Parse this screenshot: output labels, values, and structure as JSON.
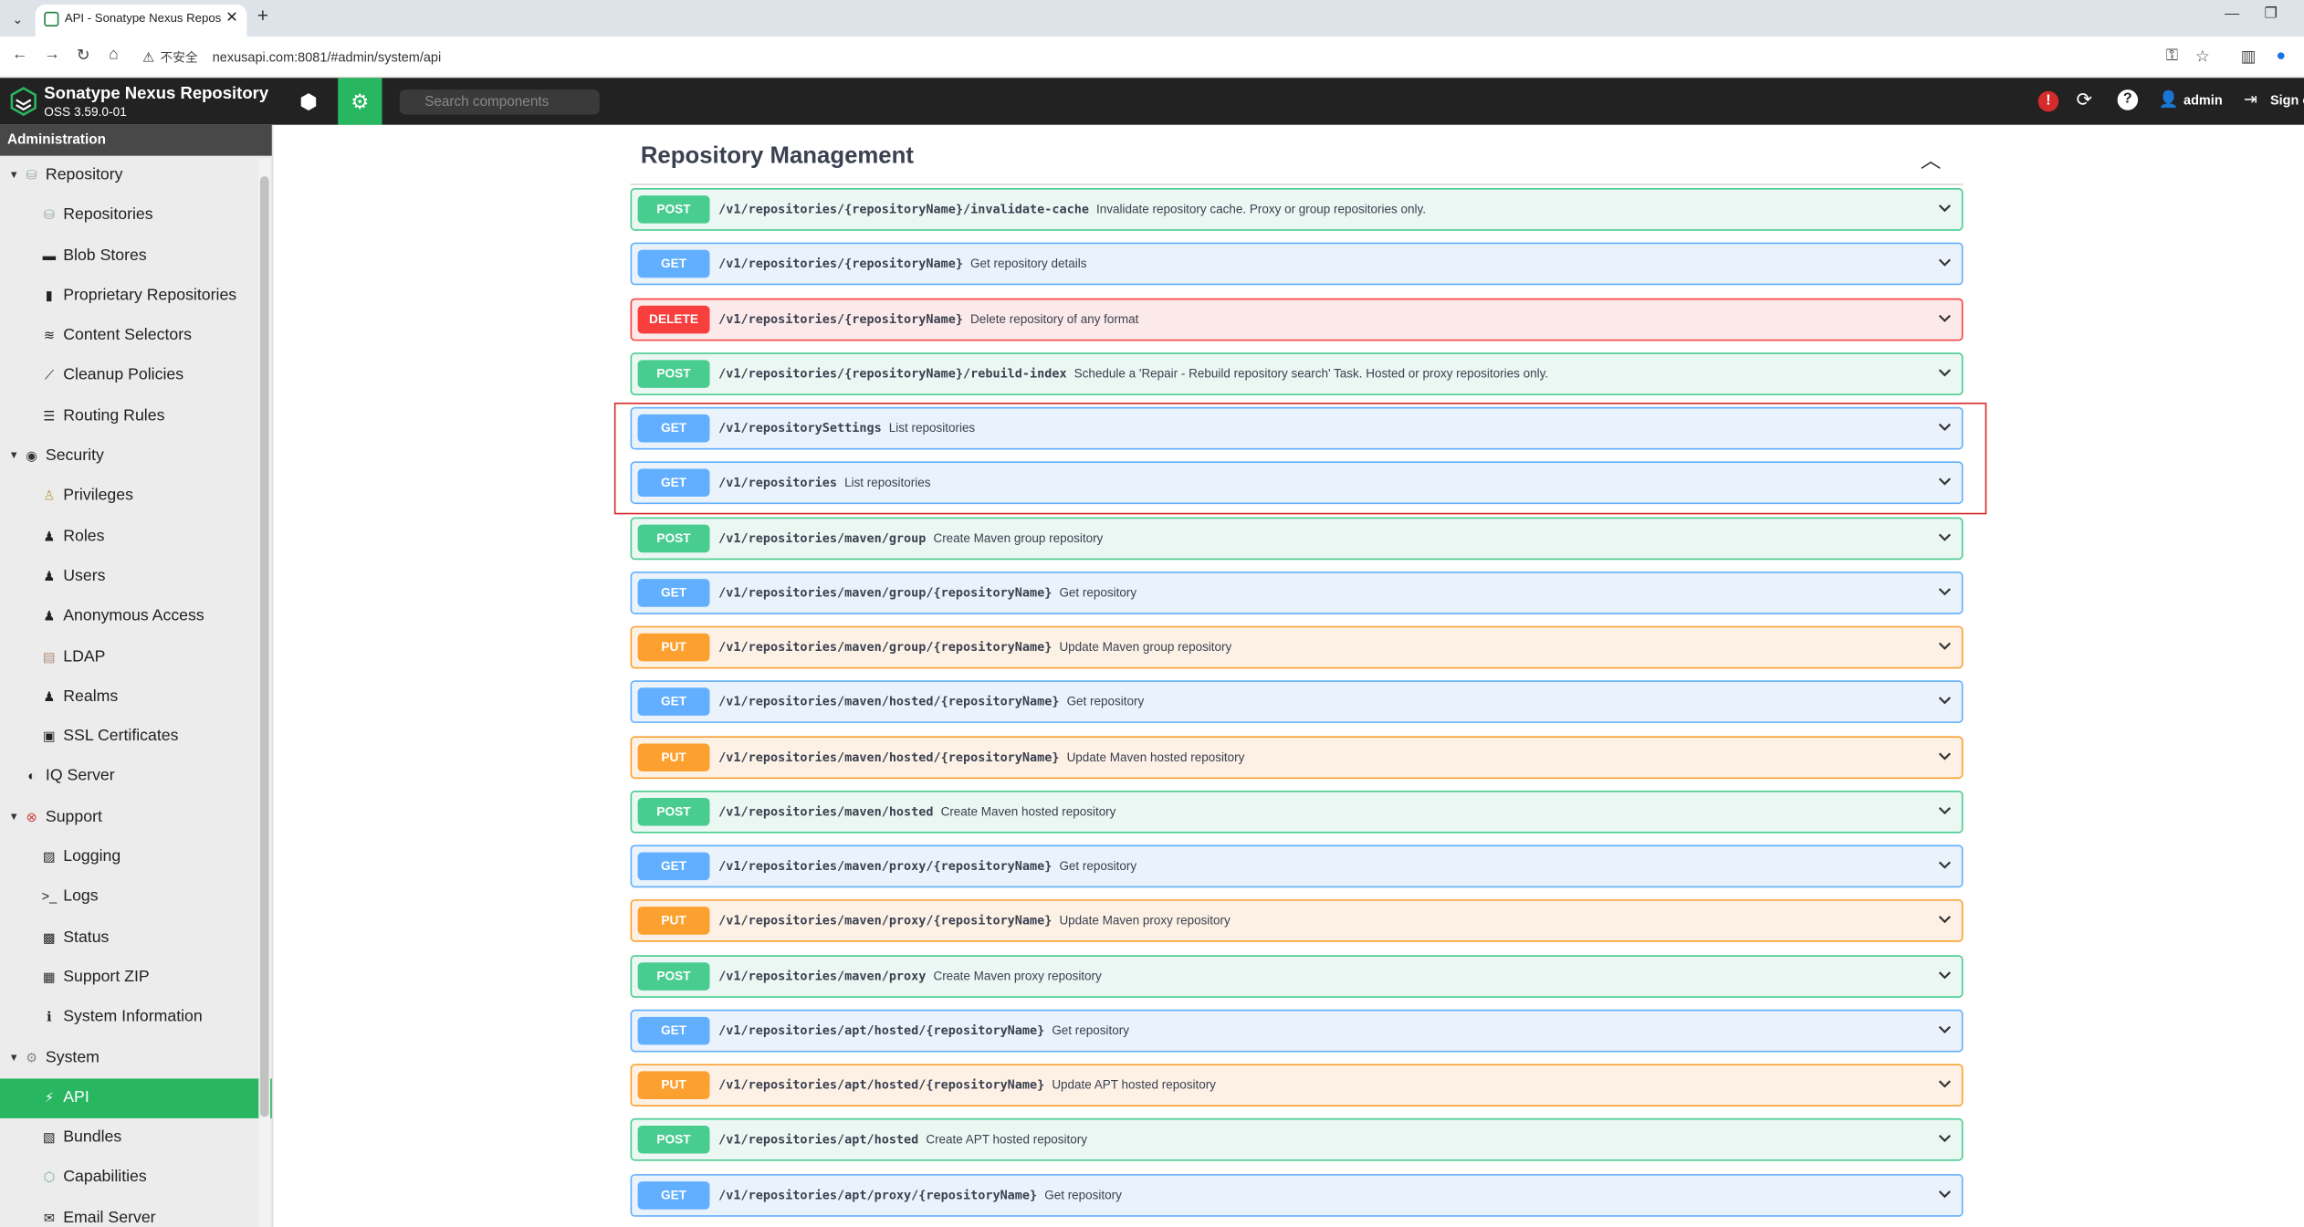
{
  "browser": {
    "tab_title": "API - Sonatype Nexus Repos",
    "new_tab": "+",
    "security_label": "不安全",
    "url": "nexusapi.com:8081/#admin/system/api"
  },
  "app": {
    "brand": "Sonatype Nexus Repository",
    "version": "OSS 3.59.0-01",
    "search_placeholder": "Search components",
    "user": "admin",
    "sign_out": "Sign out",
    "alert_mark": "!"
  },
  "sidebar": {
    "header": "Administration",
    "items": [
      {
        "label": "Repository",
        "level": "group",
        "caret": "▼",
        "icon": "database-icon"
      },
      {
        "label": "Repositories",
        "level": "child",
        "icon": "database-icon"
      },
      {
        "label": "Blob Stores",
        "level": "child",
        "icon": "hdd-icon"
      },
      {
        "label": "Proprietary Repositories",
        "level": "child",
        "icon": "document-icon"
      },
      {
        "label": "Content Selectors",
        "level": "child",
        "icon": "layers-icon"
      },
      {
        "label": "Cleanup Policies",
        "level": "child",
        "icon": "broom-icon"
      },
      {
        "label": "Routing Rules",
        "level": "child",
        "icon": "signpost-icon"
      },
      {
        "label": "Security",
        "level": "group",
        "caret": "▼",
        "icon": "eye-icon"
      },
      {
        "label": "Privileges",
        "level": "child",
        "icon": "medal-icon"
      },
      {
        "label": "Roles",
        "level": "child",
        "icon": "user-gear-icon"
      },
      {
        "label": "Users",
        "level": "child",
        "icon": "users-icon"
      },
      {
        "label": "Anonymous Access",
        "level": "child",
        "icon": "user-icon"
      },
      {
        "label": "LDAP",
        "level": "child",
        "icon": "book-icon"
      },
      {
        "label": "Realms",
        "level": "child",
        "icon": "users-icon"
      },
      {
        "label": "SSL Certificates",
        "level": "child",
        "icon": "id-card-icon"
      },
      {
        "label": "IQ Server",
        "level": "group",
        "icon": "shield-icon"
      },
      {
        "label": "Support",
        "level": "group",
        "caret": "▼",
        "icon": "lifebuoy-icon"
      },
      {
        "label": "Logging",
        "level": "child",
        "icon": "scroll-icon"
      },
      {
        "label": "Logs",
        "level": "child",
        "icon": "terminal-icon"
      },
      {
        "label": "Status",
        "level": "child",
        "icon": "medkit-icon"
      },
      {
        "label": "Support ZIP",
        "level": "child",
        "icon": "archive-icon"
      },
      {
        "label": "System Information",
        "level": "child",
        "icon": "info-icon"
      },
      {
        "label": "System",
        "level": "group",
        "caret": "▼",
        "icon": "gear-icon"
      },
      {
        "label": "API",
        "level": "child",
        "icon": "plug-icon",
        "active": true
      },
      {
        "label": "Bundles",
        "level": "child",
        "icon": "puzzle-icon"
      },
      {
        "label": "Capabilities",
        "level": "child",
        "icon": "cube-icon"
      },
      {
        "label": "Email Server",
        "level": "child",
        "icon": "envelope-icon"
      }
    ]
  },
  "main": {
    "section_title": "Repository Management",
    "operations": [
      {
        "method": "POST",
        "path": "/v1/repositories/{repositoryName}/invalidate-cache",
        "desc": "Invalidate repository cache. Proxy or group repositories only."
      },
      {
        "method": "GET",
        "path": "/v1/repositories/{repositoryName}",
        "desc": "Get repository details"
      },
      {
        "method": "DELETE",
        "path": "/v1/repositories/{repositoryName}",
        "desc": "Delete repository of any format"
      },
      {
        "method": "POST",
        "path": "/v1/repositories/{repositoryName}/rebuild-index",
        "desc": "Schedule a 'Repair - Rebuild repository search' Task. Hosted or proxy repositories only."
      },
      {
        "method": "GET",
        "path": "/v1/repositorySettings",
        "desc": "List repositories"
      },
      {
        "method": "GET",
        "path": "/v1/repositories",
        "desc": "List repositories"
      },
      {
        "method": "POST",
        "path": "/v1/repositories/maven/group",
        "desc": "Create Maven group repository"
      },
      {
        "method": "GET",
        "path": "/v1/repositories/maven/group/{repositoryName}",
        "desc": "Get repository"
      },
      {
        "method": "PUT",
        "path": "/v1/repositories/maven/group/{repositoryName}",
        "desc": "Update Maven group repository"
      },
      {
        "method": "GET",
        "path": "/v1/repositories/maven/hosted/{repositoryName}",
        "desc": "Get repository"
      },
      {
        "method": "PUT",
        "path": "/v1/repositories/maven/hosted/{repositoryName}",
        "desc": "Update Maven hosted repository"
      },
      {
        "method": "POST",
        "path": "/v1/repositories/maven/hosted",
        "desc": "Create Maven hosted repository"
      },
      {
        "method": "GET",
        "path": "/v1/repositories/maven/proxy/{repositoryName}",
        "desc": "Get repository"
      },
      {
        "method": "PUT",
        "path": "/v1/repositories/maven/proxy/{repositoryName}",
        "desc": "Update Maven proxy repository"
      },
      {
        "method": "POST",
        "path": "/v1/repositories/maven/proxy",
        "desc": "Create Maven proxy repository"
      },
      {
        "method": "GET",
        "path": "/v1/repositories/apt/hosted/{repositoryName}",
        "desc": "Get repository"
      },
      {
        "method": "PUT",
        "path": "/v1/repositories/apt/hosted/{repositoryName}",
        "desc": "Update APT hosted repository"
      },
      {
        "method": "POST",
        "path": "/v1/repositories/apt/hosted",
        "desc": "Create APT hosted repository"
      },
      {
        "method": "GET",
        "path": "/v1/repositories/apt/proxy/{repositoryName}",
        "desc": "Get repository"
      }
    ]
  },
  "colors": {
    "post": "#49cc90",
    "get": "#61affe",
    "put": "#fca130",
    "delete": "#f93e3e",
    "accent": "#29b661",
    "highlight": "#d62828"
  }
}
